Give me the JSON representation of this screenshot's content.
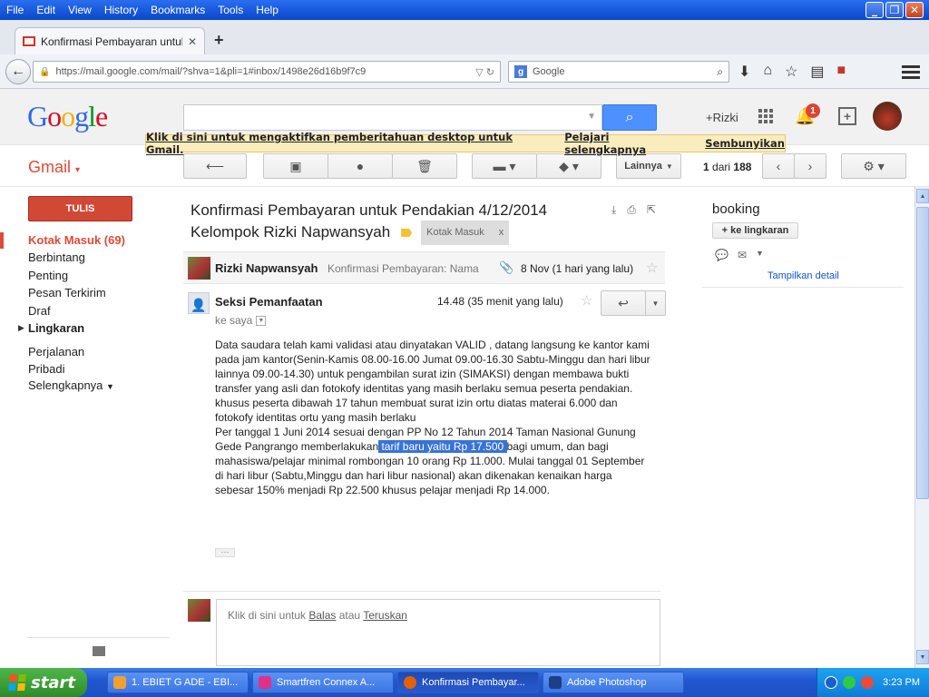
{
  "browser": {
    "menus": [
      "File",
      "Edit",
      "View",
      "History",
      "Bookmarks",
      "Tools",
      "Help"
    ],
    "tab_title": "Konfirmasi Pembayaran untuk...",
    "url": "https://mail.google.com/mail/?shva=1&pli=1#inbox/1498e26d16b9f7c9",
    "search_engine_placeholder": "Google"
  },
  "gmail": {
    "logo": "Google",
    "user_link": "+Rizki",
    "notification_count": "1",
    "desktop_notice": {
      "enable": "Klik di sini untuk mengaktifkan pemberitahuan desktop untuk Gmail.",
      "learn_more": "Pelajari selengkapnya",
      "hide": "Sembunyikan"
    },
    "product_label": "Gmail",
    "more_button": "Lainnya",
    "pager": {
      "current": "1",
      "of": "dari",
      "total": "188"
    },
    "compose_label": "TULIS",
    "nav": [
      {
        "label": "Kotak Masuk (69)"
      },
      {
        "label": "Berbintang"
      },
      {
        "label": "Penting"
      },
      {
        "label": "Pesan Terkirim"
      },
      {
        "label": "Draf"
      },
      {
        "label": "Lingkaran"
      },
      {
        "label": "Perjalanan"
      },
      {
        "label": "Pribadi"
      },
      {
        "label": "Selengkapnya"
      }
    ]
  },
  "thread": {
    "subject_line1": "Konfirmasi Pembayaran untuk Pendakian 4/12/2014",
    "subject_line2": "Kelompok Rizki Napwansyah",
    "label_chip": "Kotak Masuk",
    "label_chip_close": "x",
    "collapsed": {
      "sender": "Rizki Napwansyah",
      "snippet": "Konfirmasi Pembayaran: Nama",
      "date": "8 Nov (1 hari yang lalu)"
    },
    "expanded": {
      "sender": "Seksi Pemanfaatan",
      "recipient": "ke saya",
      "time": "14.48 (35 menit yang lalu)",
      "body_part1": "Data saudara telah kami validasi atau dinyatakan VALID , datang langsung ke kantor kami pada jam kantor(Senin-Kamis 08.00-16.00 Jumat 09.00-16.30 Sabtu-Minggu dan hari libur lainnya 09.00-14.30) untuk pengambilan surat izin (SIMAKSI) dengan membawa bukti transfer yang asli dan fotokofy identitas yang masih berlaku semua peserta pendakian.",
      "body_part2": "khusus peserta dibawah 17 tahun membuat surat izin ortu diatas materai 6.000 dan fotokofy identitas ortu yang masih berlaku",
      "body_part3a": "Per tanggal 1 Juni 2014 sesuai dengan PP No 12 Tahun 2014 Taman Nasional Gunung Gede Pangrango memberlakukan",
      "body_highlight": " tarif baru yaitu Rp 17.500 ",
      "body_part3b": "bagi umum, dan bagi mahasiswa/pelajar minimal rombongan 10 orang Rp 11.000.  Mulai tanggal 01 September di hari libur (Sabtu,Minggu dan hari libur nasional) akan dikenakan kenaikan harga sebesar 150% menjadi Rp 22.500 khusus pelajar menjadi Rp 14.000.",
      "ellipsis": "···"
    },
    "reply": {
      "prefix": "Klik di sini untuk ",
      "reply": "Balas",
      "mid": " atau ",
      "forward": "Teruskan"
    }
  },
  "contact": {
    "name": "booking",
    "circles_button": "+ ke lingkaran",
    "details_link": "Tampilkan detail"
  },
  "taskbar": {
    "start": "start",
    "tasks": [
      {
        "label": "1. EBIET G ADE - EBI..."
      },
      {
        "label": "Smartfren Connex A..."
      },
      {
        "label": "Konfirmasi Pembayar..."
      },
      {
        "label": "Adobe Photoshop"
      }
    ],
    "clock": "3:23 PM"
  }
}
